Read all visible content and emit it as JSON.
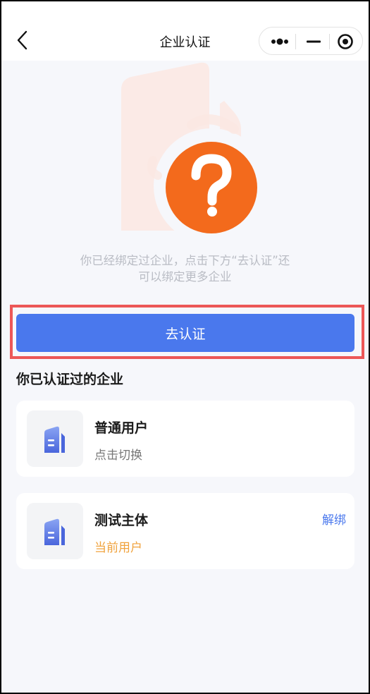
{
  "navbar": {
    "title": "企业认证",
    "icons": [
      "back-icon",
      "more-icon",
      "minimize-icon",
      "close-target-icon"
    ]
  },
  "hint": {
    "line1": "你已经绑定过企业，点击下方“去认证”还",
    "line2": "可以绑定更多企业"
  },
  "cta": {
    "label": "去认证"
  },
  "section": {
    "title": "你已认证过的企业"
  },
  "companies": [
    {
      "name": "普通用户",
      "sub": "点击切换",
      "icon": "building-icon"
    },
    {
      "name": "测试主体",
      "sub": "当前用户",
      "action": "解绑",
      "icon": "building-icon"
    }
  ],
  "colors": {
    "primary": "#4a78ed",
    "highlight": "#ec5757",
    "current": "#f0a23c",
    "question": "#f36a1c"
  }
}
